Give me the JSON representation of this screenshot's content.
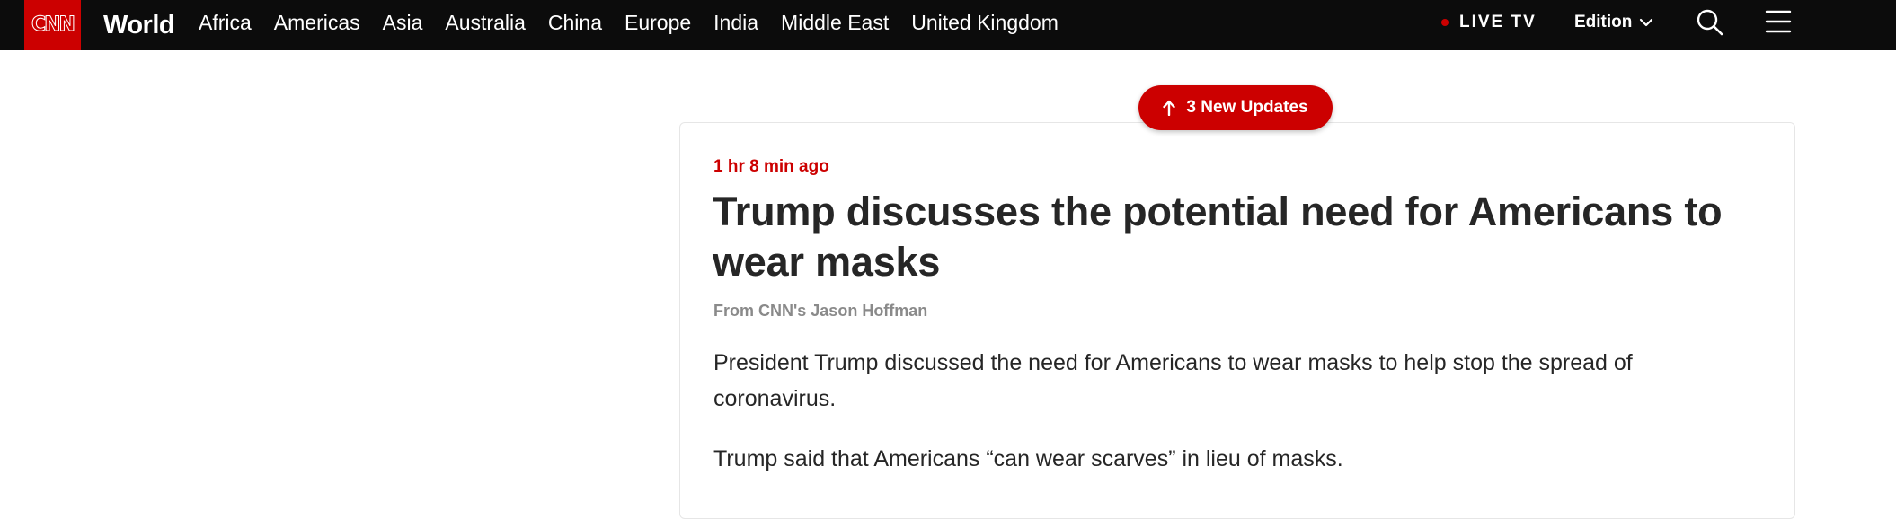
{
  "header": {
    "logo": "CNN",
    "section": "World",
    "nav_items": [
      "Africa",
      "Americas",
      "Asia",
      "Australia",
      "China",
      "Europe",
      "India",
      "Middle East",
      "United Kingdom"
    ],
    "live_tv": "LIVE TV",
    "edition": "Edition",
    "icons": {
      "live": "live-dot-icon",
      "edition": "chevron-down-icon",
      "search": "search-icon",
      "menu": "hamburger-menu-icon"
    }
  },
  "updates_pill": {
    "label": "3 New Updates",
    "icon": "arrow-up-icon"
  },
  "post": {
    "timestamp": "1 hr 8 min ago",
    "headline": "Trump discusses the potential need for Americans to wear masks",
    "byline": "From CNN's Jason Hoffman",
    "paragraphs": [
      "President Trump discussed the need for Americans to wear masks to help stop the spread of coronavirus.",
      "Trump said that Americans “can wear scarves” in lieu of masks."
    ]
  },
  "colors": {
    "brand_red": "#cc0000",
    "topbar": "#0c0c0c",
    "text": "#262626",
    "byline": "#8a8a8a"
  }
}
